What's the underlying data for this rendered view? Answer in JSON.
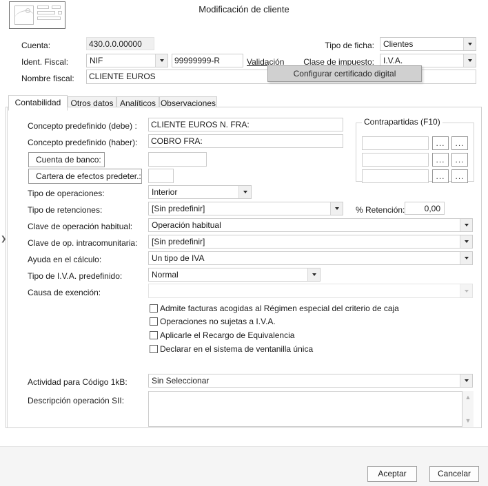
{
  "window": {
    "title": "Modificación de cliente",
    "thumb_icon": "image-card-icon"
  },
  "header_form": {
    "cuenta_label": "Cuenta:",
    "cuenta_value": "430.0.0.00000",
    "ident_fiscal_label": "Ident. Fiscal:",
    "ident_fiscal_type": "NIF",
    "ident_fiscal_value": "99999999-R",
    "validacion_link": "Validación",
    "nombre_fiscal_label": "Nombre fiscal:",
    "nombre_fiscal_value": "CLIENTE EUROS",
    "tipo_ficha_label": "Tipo de ficha:",
    "tipo_ficha_value": "Clientes",
    "clase_impuesto_label": "Clase de impuesto:",
    "clase_impuesto_value": "I.V.A."
  },
  "context_menu": {
    "items": [
      {
        "label": "Configurar certificado digital"
      }
    ]
  },
  "tabs": [
    {
      "label": "Contabilidad",
      "active": true
    },
    {
      "label": "Otros datos",
      "active": false
    },
    {
      "label": "Analíticos",
      "active": false
    },
    {
      "label": "Observaciones",
      "active": false
    }
  ],
  "contabilidad": {
    "concepto_debe_label": "Concepto predefinido (debe) :",
    "concepto_debe_value": "CLIENTE EUROS N. FRA:",
    "concepto_haber_label": "Concepto predefinido (haber):",
    "concepto_haber_value": "COBRO FRA:",
    "cuenta_banco_button": "Cuenta de banco:",
    "cuenta_banco_value": "",
    "cartera_efectos_button": "Cartera de efectos predeter.:",
    "cartera_efectos_value": "",
    "tipo_operaciones_label": "Tipo de operaciones:",
    "tipo_operaciones_value": "Interior",
    "tipo_retenciones_label": "Tipo de retenciones:",
    "tipo_retenciones_value": "[Sin predefinir]",
    "pct_retencion_label": "% Retención:",
    "pct_retencion_value": "0,00",
    "clave_operacion_label": "Clave de operación habitual:",
    "clave_operacion_value": "Operación habitual",
    "clave_intracom_label": "Clave de op. intracomunitaria:",
    "clave_intracom_value": "[Sin predefinir]",
    "ayuda_calculo_label": "Ayuda en el cálculo:",
    "ayuda_calculo_value": "Un tipo de IVA",
    "tipo_iva_label": "Tipo de I.V.A. predefinido:",
    "tipo_iva_value": "Normal",
    "causa_exencion_label": "Causa de exención:",
    "causa_exencion_value": "",
    "actividad_label": "Actividad para Código 1kB:",
    "actividad_value": "Sin Seleccionar",
    "descripcion_sii_label": "Descripción operación SII:",
    "descripcion_sii_value": "",
    "checkboxes": [
      {
        "label": "Admite facturas acogidas al Régimen especial del criterio de caja",
        "checked": false
      },
      {
        "label": "Operaciones no sujetas a I.V.A.",
        "checked": false
      },
      {
        "label": "Aplicarle el Recargo de Equivalencia",
        "checked": false
      },
      {
        "label": "Declarar en el sistema de ventanilla única",
        "checked": false
      }
    ]
  },
  "contrapartidas": {
    "legend": "Contrapartidas (F10)",
    "rows": [
      {
        "value": "",
        "btn1": "...",
        "btn2": "..."
      },
      {
        "value": "",
        "btn1": "...",
        "btn2": "..."
      },
      {
        "value": "",
        "btn1": "...",
        "btn2": "..."
      }
    ]
  },
  "side_expander": {
    "glyph": "❯"
  },
  "footer": {
    "accept_label": "Aceptar",
    "cancel_label": "Cancelar"
  },
  "scrollbar": {
    "up": "▲",
    "down": "▼"
  }
}
